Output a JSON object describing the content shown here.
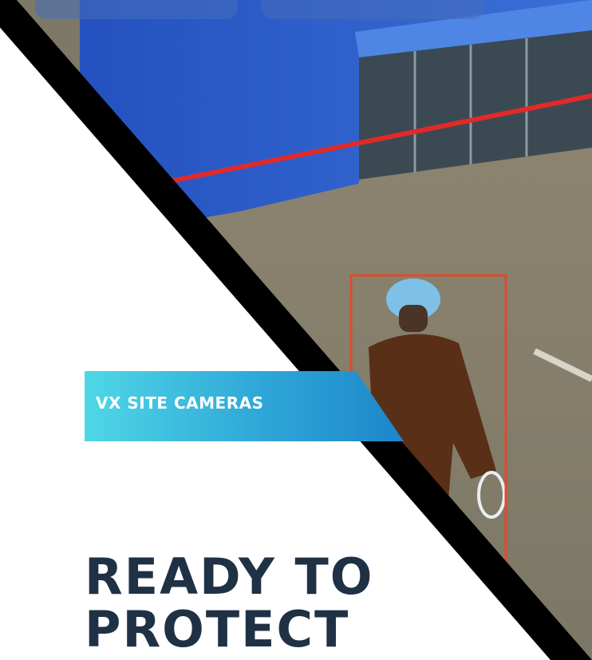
{
  "badge": {
    "label": "VX SITE CAMERAS"
  },
  "headline": {
    "line1": "READY TO",
    "line2": "PROTECT"
  },
  "colors": {
    "navy_text": "#1f3144",
    "badge_start": "#4fd7e6",
    "badge_end": "#1d86c9",
    "wall_blue": "#2f5fc8",
    "detection_red": "#e02a2a"
  },
  "icons": {
    "detection_box": "bounding-box-icon",
    "tripwire": "tripwire-line"
  }
}
